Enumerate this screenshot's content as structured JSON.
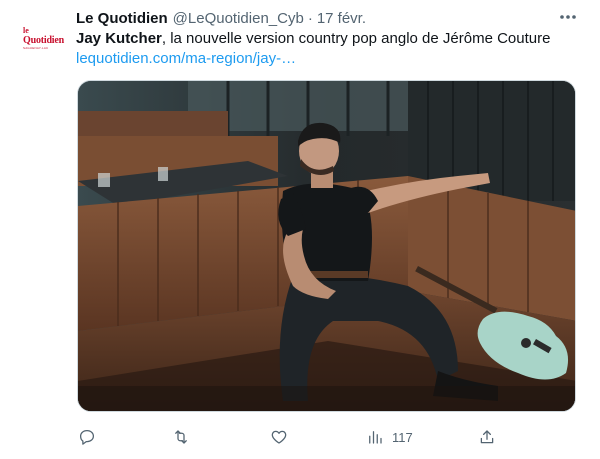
{
  "author": {
    "logo_top": "le",
    "logo_main": "Quotidien",
    "logo_sub": "SAGUENAY-LAC",
    "name": "Le Quotidien",
    "handle": "@LeQuotidien_Cyb",
    "separator": "·",
    "timestamp": "17 févr."
  },
  "tweet": {
    "text_bold": "Jay Kutcher",
    "text_rest": ", la nouvelle version country pop anglo de Jérôme Couture",
    "link": "lequotidien.com/ma-region/jay-…"
  },
  "media": {
    "description_icon": "photo-image"
  },
  "actions": {
    "reply_icon": "reply-icon",
    "retweet_icon": "retweet-icon",
    "like_icon": "heart-icon",
    "views_icon": "views-icon",
    "views_count": "117",
    "share_icon": "share-icon"
  },
  "colors": {
    "accent_link": "#1d9bf0",
    "secondary_text": "#536471",
    "logo_red": "#c8102e"
  }
}
